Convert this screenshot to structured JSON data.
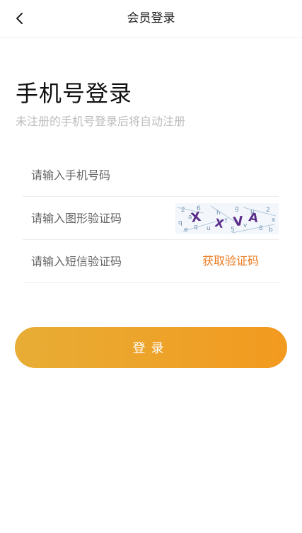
{
  "header": {
    "title": "会员登录",
    "back_icon": "chevron-left-icon"
  },
  "main": {
    "heading": "手机号登录",
    "subheading": "未注册的手机号登录后将自动注册"
  },
  "form": {
    "phone_placeholder": "请输入手机号码",
    "captcha_placeholder": "请输入图形验证码",
    "sms_placeholder": "请输入短信验证码",
    "get_code_label": "获取验证码",
    "captcha_image_text": "XXVA"
  },
  "actions": {
    "login_label": "登录"
  },
  "colors": {
    "accent": "#ec7a1f",
    "button_gradient_start": "#e8ad35",
    "button_gradient_end": "#f29a1f",
    "subtext": "#bdbdbd"
  }
}
